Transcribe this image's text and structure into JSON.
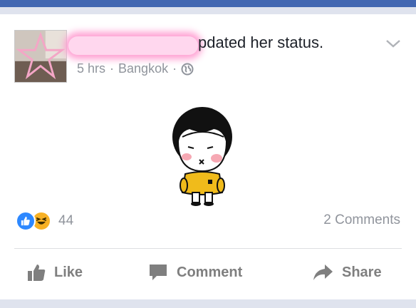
{
  "post": {
    "headline_visible": "pdated her status.",
    "meta": {
      "time": "5 hrs",
      "separator": "·",
      "location": "Bangkok",
      "privacy_icon": "globe-icon"
    },
    "menu_icon": "chevron-down-icon",
    "content_sticker": "girl-sticker"
  },
  "reactions": {
    "types": [
      "like",
      "haha"
    ],
    "count": "44"
  },
  "comments": {
    "label": "2 Comments"
  },
  "actions": {
    "like": "Like",
    "comment": "Comment",
    "share": "Share"
  },
  "colors": {
    "brand": "#4267b2",
    "like_blue": "#2d88ff",
    "haha_yellow": "#f7b125",
    "muted_text": "#90949c",
    "redaction_pink": "#ff9fd2"
  }
}
